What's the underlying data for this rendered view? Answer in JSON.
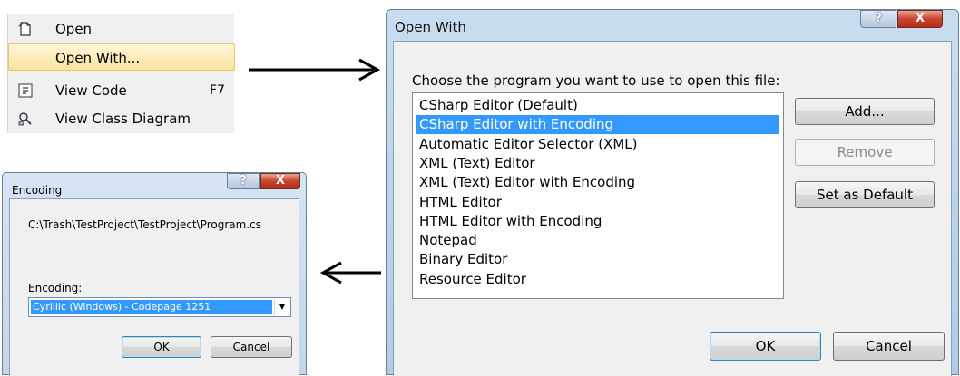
{
  "context_menu": {
    "items": [
      {
        "label": "Open",
        "mnemonic": "O",
        "shortcut": "",
        "icon": "document-open-icon",
        "highlighted": false
      },
      {
        "label": "Open With...",
        "mnemonic": "W",
        "shortcut": "",
        "icon": "",
        "highlighted": true
      },
      {
        "label": "View Code",
        "mnemonic": "C",
        "shortcut": "F7",
        "icon": "view-code-icon",
        "highlighted": false
      },
      {
        "label": "View Class Diagram",
        "mnemonic": "V",
        "shortcut": "",
        "icon": "class-diagram-icon",
        "highlighted": false
      }
    ]
  },
  "open_with": {
    "title": "Open With",
    "prompt": "Choose the program you want to use to open this file:",
    "programs": [
      "CSharp Editor (Default)",
      "CSharp Editor with Encoding",
      "Automatic Editor Selector (XML)",
      "XML (Text) Editor",
      "XML (Text) Editor with Encoding",
      "HTML Editor",
      "HTML Editor with Encoding",
      "Notepad",
      "Binary Editor",
      "Resource Editor"
    ],
    "selected_index": 1,
    "buttons": {
      "add": "Add...",
      "remove": "Remove",
      "set_default": "Set as Default",
      "ok": "OK",
      "cancel": "Cancel"
    },
    "caption": {
      "help": "?",
      "close": "X"
    }
  },
  "encoding": {
    "title": "Encoding",
    "path": "C:\\Trash\\TestProject\\TestProject\\Program.cs",
    "label": "Encoding:",
    "selected": "Cyrillic (Windows) - Codepage 1251",
    "ok": "OK",
    "cancel": "Cancel",
    "caption": {
      "help": "?",
      "close": "X"
    }
  },
  "colors": {
    "selection": "#3399ff",
    "menu_highlight": "#f9e39d",
    "close_button": "#c7452f"
  }
}
